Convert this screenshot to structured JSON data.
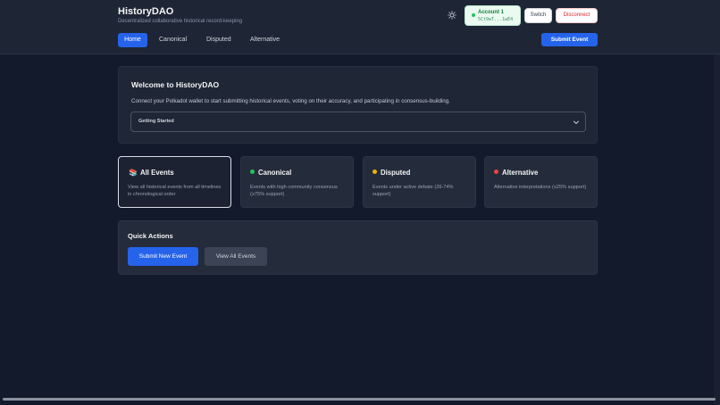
{
  "app": {
    "title": "HistoryDAO",
    "subtitle": "Decentralized collaborative historical record-keeping"
  },
  "account": {
    "name": "Account 1",
    "address": "5Ct9wT...1wE4",
    "status_color": "#22c55e"
  },
  "header_buttons": {
    "switch": "Switch",
    "disconnect": "Disconnect",
    "submit_event": "Submit Event"
  },
  "nav": {
    "home": "Home",
    "canonical": "Canonical",
    "disputed": "Disputed",
    "alternative": "Alternative"
  },
  "welcome": {
    "title": "Welcome to HistoryDAO",
    "text": "Connect your Polkadot wallet to start submitting historical events, voting on their accuracy, and participating in consensus-building.",
    "dropdown_label": "Getting Started"
  },
  "categories": [
    {
      "title": "All Events",
      "icon": "books-icon",
      "description": "View all historical events from all timelines in chronological order"
    },
    {
      "title": "Canonical",
      "color": "#22c55e",
      "description": "Events with high community consensus (≥75% support)"
    },
    {
      "title": "Disputed",
      "color": "#eab308",
      "description": "Events under active debate (26-74% support)"
    },
    {
      "title": "Alternative",
      "color": "#ef4444",
      "description": "Alternative interpretations (≤25% support)"
    }
  ],
  "quick_actions": {
    "title": "Quick Actions",
    "submit": "Submit New Event",
    "view_all": "View All Events"
  },
  "colors": {
    "accent": "#2563eb",
    "background": "#131a2b",
    "surface": "#242b3a"
  }
}
